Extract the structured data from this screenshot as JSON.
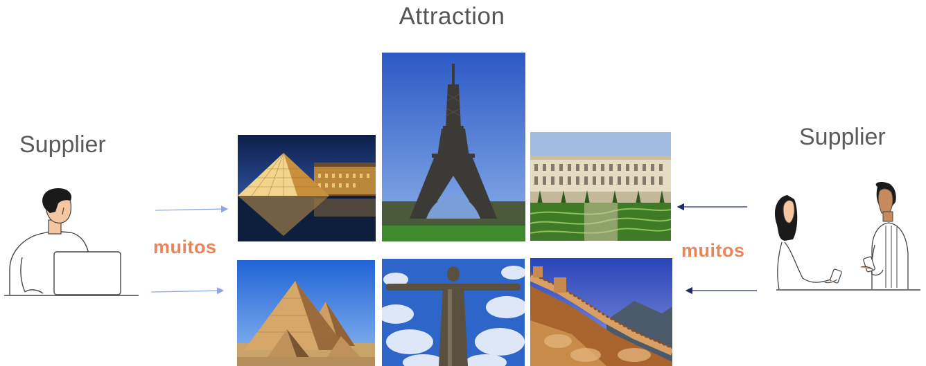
{
  "title": "Attraction",
  "suppliers": {
    "left_label": "Supplier",
    "right_label": "Supplier"
  },
  "relations": {
    "left_label": "muitos",
    "right_label": "muitos"
  },
  "colors": {
    "muitos": "#e8865a",
    "left_arrow": "#8ea6e6",
    "right_arrow": "#1e2a6e",
    "text": "#555555"
  },
  "attractions": [
    {
      "icon": "louvre-pyramid-photo"
    },
    {
      "icon": "eiffel-tower-photo"
    },
    {
      "icon": "versailles-palace-photo"
    },
    {
      "icon": "giza-pyramids-photo"
    },
    {
      "icon": "christ-the-redeemer-photo"
    },
    {
      "icon": "great-wall-photo"
    }
  ]
}
